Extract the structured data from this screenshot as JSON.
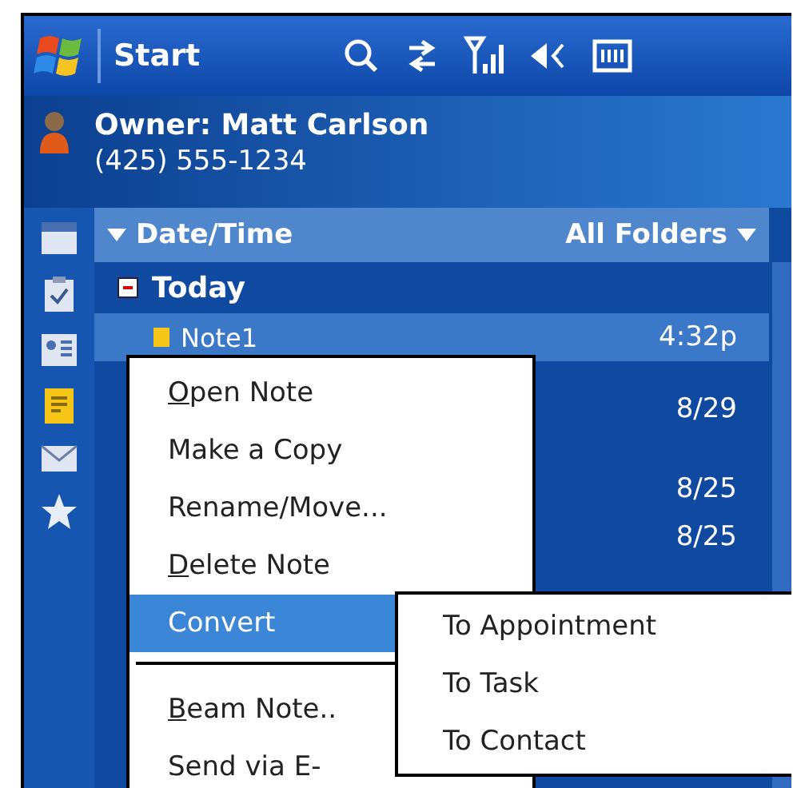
{
  "title_bar": {
    "title": "Start"
  },
  "owner": {
    "name": "Owner: Matt Carlson",
    "phone": "(425) 555-1234"
  },
  "sort_bar": {
    "sort": "Date/Time",
    "folder": "All Folders"
  },
  "list": {
    "group": "Today",
    "expanded": true,
    "rows": [
      {
        "name": "Note1",
        "time": "4:32p",
        "selected": true
      },
      {
        "time": "8/29",
        "selected": false
      },
      {
        "time": "8/25",
        "selected": false
      },
      {
        "time": "8/25",
        "selected": false
      }
    ]
  },
  "context_menu": {
    "items": [
      {
        "kind": "item",
        "label": "Open Note",
        "underline_first": true,
        "selected": false
      },
      {
        "kind": "item",
        "label": "Make a Copy",
        "underline_first": false,
        "selected": false
      },
      {
        "kind": "item",
        "label": "Rename/Move...",
        "underline_first": false,
        "selected": false
      },
      {
        "kind": "item",
        "label": "Delete Note",
        "underline_first": true,
        "selected": false
      },
      {
        "kind": "item",
        "label": "Convert",
        "underline_first": false,
        "selected": true
      },
      {
        "kind": "separator"
      },
      {
        "kind": "item",
        "label": "Beam Note..",
        "underline_first": true,
        "selected": false
      },
      {
        "kind": "item",
        "label": "Send via E-",
        "underline_first": false,
        "selected": false
      }
    ]
  },
  "submenu": {
    "items": [
      {
        "label": "To Appointment"
      },
      {
        "label": "To Task"
      },
      {
        "label": "To Contact"
      }
    ]
  }
}
